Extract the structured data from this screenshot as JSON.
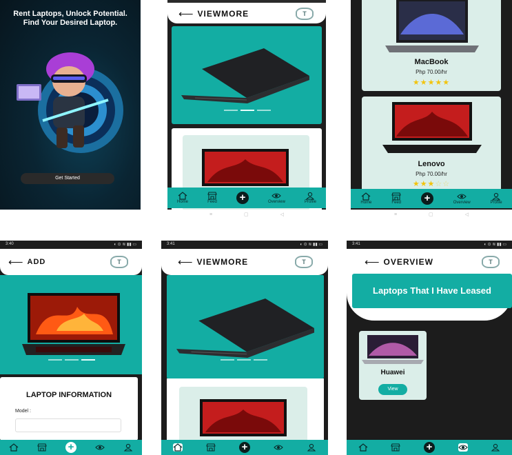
{
  "colors": {
    "teal": "#13ada3",
    "dark": "#1c1c1c",
    "card": "#dbeee9"
  },
  "splash": {
    "headline": "Rent Laptops, Unlock Potential. Find Your Desired Laptop.",
    "button": "Get Started"
  },
  "viewmore": {
    "title": "VIEWMORE"
  },
  "add": {
    "title": "ADD",
    "section": "LAPTOP INFORMATION",
    "model_label": "Model :",
    "model_value": ""
  },
  "overview": {
    "title": "OVERVIEW",
    "banner": "Laptops That I Have Leased",
    "card_name": "Huawei",
    "card_button": "View"
  },
  "listing": {
    "items": [
      {
        "name": "MacBook",
        "price": "Php 70.00/hr",
        "rating": 5
      },
      {
        "name": "Lenovo",
        "price": "Php 70.00/hr",
        "rating": 3
      }
    ]
  },
  "status": {
    "time_a": "3:40",
    "time_b": "3:41",
    "time_c": "3:41"
  },
  "nav": {
    "home": "Home",
    "feed": "Feed",
    "overview": "Overview",
    "profile": "Profile"
  }
}
